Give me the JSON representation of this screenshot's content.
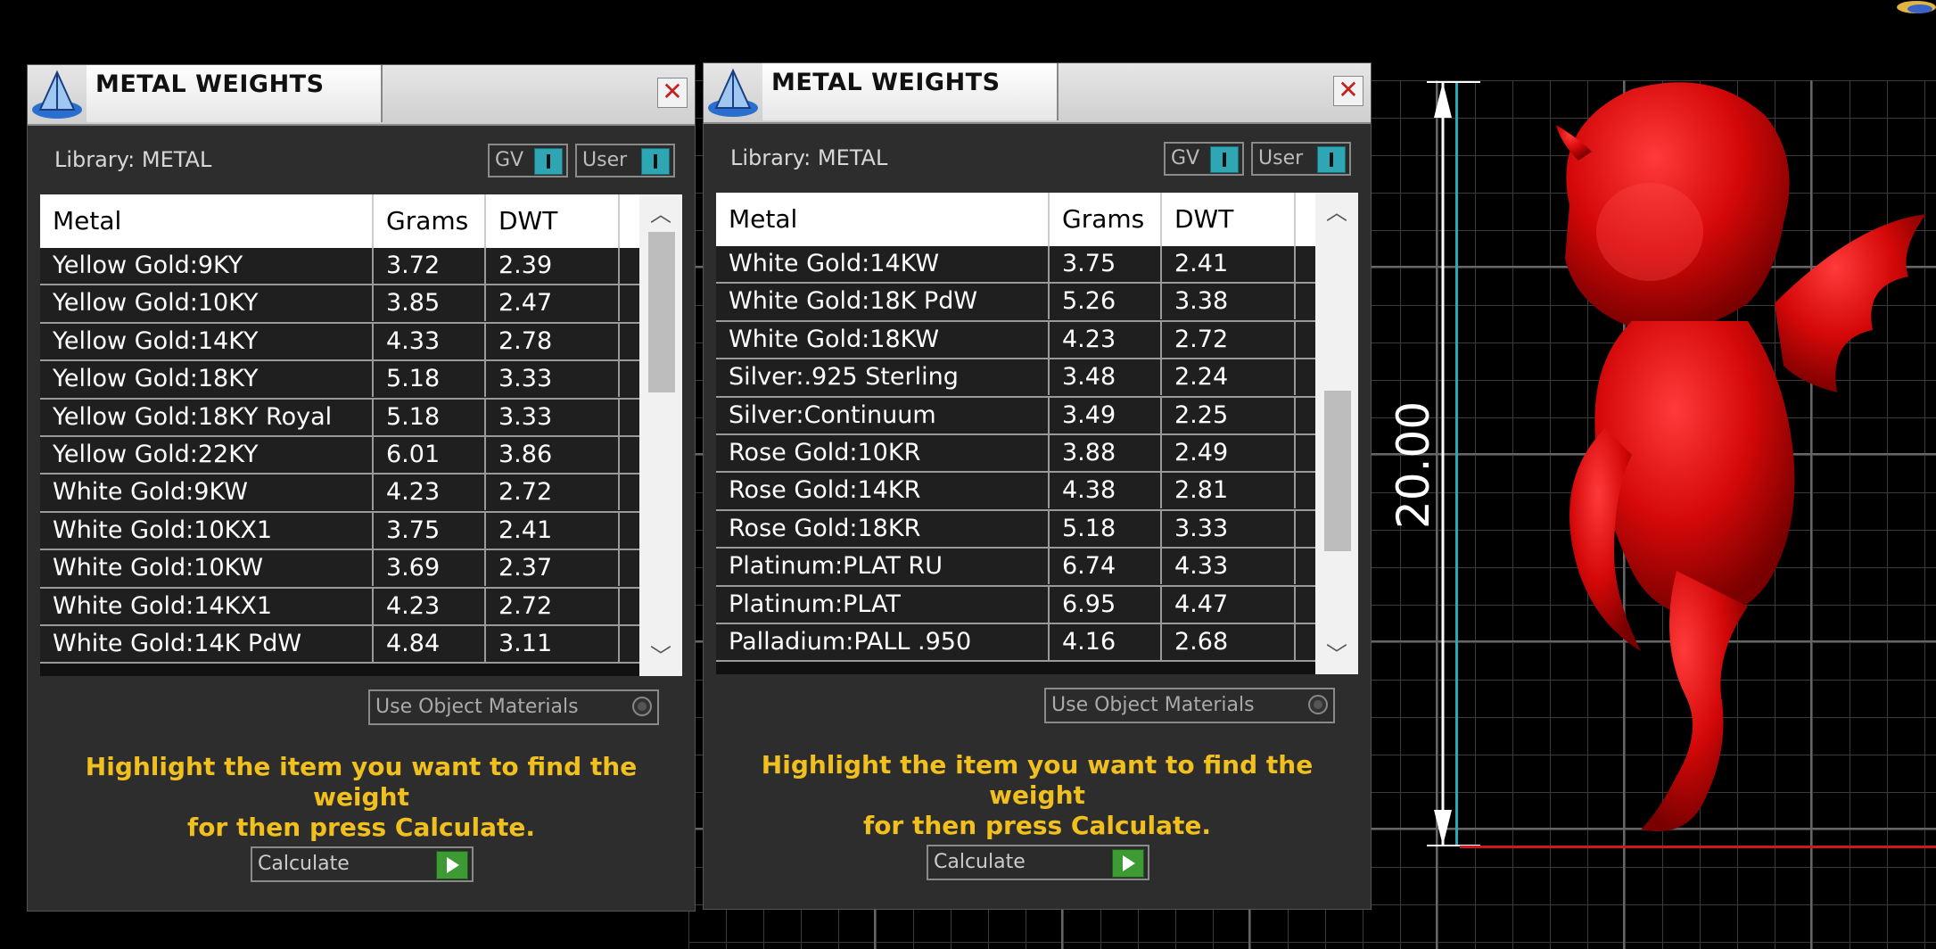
{
  "dimension": {
    "label": "20.00"
  },
  "panels": [
    {
      "title": "METAL WEIGHTS",
      "close": "✕",
      "library": "Library: METAL",
      "gv": "GV",
      "user": "User",
      "columns": [
        "Metal",
        "Grams",
        "DWT"
      ],
      "rows": [
        [
          "Yellow Gold:9KY",
          "3.72",
          "2.39"
        ],
        [
          "Yellow Gold:10KY",
          "3.85",
          "2.47"
        ],
        [
          "Yellow Gold:14KY",
          "4.33",
          "2.78"
        ],
        [
          "Yellow Gold:18KY",
          "5.18",
          "3.33"
        ],
        [
          "Yellow Gold:18KY Royal",
          "5.18",
          "3.33"
        ],
        [
          "Yellow Gold:22KY",
          "6.01",
          "3.86"
        ],
        [
          "White Gold:9KW",
          "4.23",
          "2.72"
        ],
        [
          "White Gold:10KX1",
          "3.75",
          "2.41"
        ],
        [
          "White Gold:10KW",
          "3.69",
          "2.37"
        ],
        [
          "White Gold:14KX1",
          "4.23",
          "2.72"
        ],
        [
          "White Gold:14K PdW",
          "4.84",
          "3.11"
        ]
      ],
      "use_object_materials": "Use Object Materials",
      "hint_line1": "Highlight the item you want to find the weight",
      "hint_line2": "for then press Calculate.",
      "calculate": "Calculate"
    },
    {
      "title": "METAL WEIGHTS",
      "close": "✕",
      "library": "Library: METAL",
      "gv": "GV",
      "user": "User",
      "columns": [
        "Metal",
        "Grams",
        "DWT"
      ],
      "rows": [
        [
          "White Gold:14KW",
          "3.75",
          "2.41"
        ],
        [
          "White Gold:18K PdW",
          "5.26",
          "3.38"
        ],
        [
          "White Gold:18KW",
          "4.23",
          "2.72"
        ],
        [
          "Silver:.925 Sterling",
          "3.48",
          "2.24"
        ],
        [
          "Silver:Continuum",
          "3.49",
          "2.25"
        ],
        [
          "Rose Gold:10KR",
          "3.88",
          "2.49"
        ],
        [
          "Rose Gold:14KR",
          "4.38",
          "2.81"
        ],
        [
          "Rose Gold:18KR",
          "5.18",
          "3.33"
        ],
        [
          "Platinum:PLAT RU",
          "6.74",
          "4.33"
        ],
        [
          "Platinum:PLAT",
          "6.95",
          "4.47"
        ],
        [
          "Palladium:PALL .950",
          "4.16",
          "2.68"
        ]
      ],
      "use_object_materials": "Use Object Materials",
      "hint_line1": "Highlight the item you want to find the weight",
      "hint_line2": "for then press Calculate.",
      "calculate": "Calculate"
    }
  ],
  "colors": {
    "accent": "#2fa6b4",
    "hint": "#f2c01e",
    "model": "#e01010",
    "go": "#3d9a35"
  }
}
